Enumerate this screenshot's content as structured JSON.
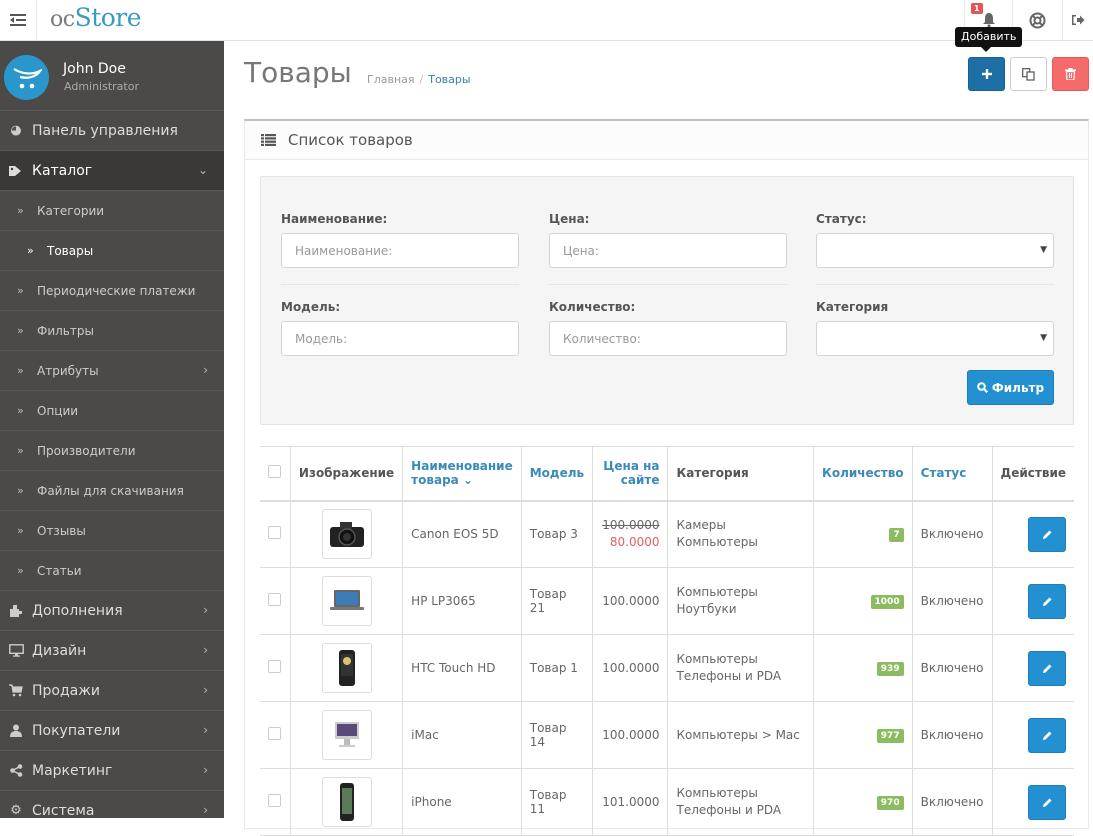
{
  "header": {
    "logo_prefix": "oc",
    "logo_brand": "Store",
    "notifications_count": "1",
    "tooltip": "Добавить"
  },
  "profile": {
    "name": "John Doe",
    "role": "Administrator"
  },
  "sidebar": {
    "items": [
      {
        "label": "Панель управления",
        "icon": "dashboard-icon"
      },
      {
        "label": "Каталог",
        "icon": "tags-icon",
        "expanded": true
      },
      {
        "label": "Дополнения",
        "icon": "puzzle-icon"
      },
      {
        "label": "Дизайн",
        "icon": "monitor-icon"
      },
      {
        "label": "Продажи",
        "icon": "cart-icon"
      },
      {
        "label": "Покупатели",
        "icon": "user-icon"
      },
      {
        "label": "Маркетинг",
        "icon": "share-icon"
      },
      {
        "label": "Система",
        "icon": "gear-icon"
      }
    ],
    "catalog_sub": [
      {
        "label": "Категории"
      },
      {
        "label": "Товары",
        "active": true
      },
      {
        "label": "Периодические платежи"
      },
      {
        "label": "Фильтры"
      },
      {
        "label": "Атрибуты",
        "has_children": true
      },
      {
        "label": "Опции"
      },
      {
        "label": "Производители"
      },
      {
        "label": "Файлы для скачивания"
      },
      {
        "label": "Отзывы"
      },
      {
        "label": "Статьи"
      }
    ]
  },
  "page": {
    "title": "Товары",
    "breadcrumb": [
      "Главная",
      "Товары"
    ],
    "panel_title": "Список товаров"
  },
  "filter": {
    "name_label": "Наименование:",
    "name_placeholder": "Наименование:",
    "price_label": "Цена:",
    "price_placeholder": "Цена:",
    "status_label": "Статус:",
    "status_value": "",
    "model_label": "Модель:",
    "model_placeholder": "Модель:",
    "quantity_label": "Количество:",
    "quantity_placeholder": "Количество:",
    "category_label": "Категория",
    "category_value": "",
    "button_label": "Фильтр"
  },
  "table": {
    "columns": {
      "image": "Изображение",
      "name": "Наименование товара",
      "model": "Модель",
      "price": "Цена на сайте",
      "category": "Категория",
      "quantity": "Количество",
      "status": "Статус",
      "action": "Действие"
    },
    "rows": [
      {
        "name": "Canon EOS 5D",
        "model": "Товар 3",
        "price": "100.0000",
        "special": "80.0000",
        "category": [
          "Камеры",
          "Компьютеры"
        ],
        "quantity": "7",
        "status": "Включено",
        "image": "camera"
      },
      {
        "name": "HP LP3065",
        "model": "Товар 21",
        "price": "100.0000",
        "special": "",
        "category": [
          "Компьютеры",
          "Ноутбуки"
        ],
        "quantity": "1000",
        "status": "Включено",
        "image": "laptop"
      },
      {
        "name": "HTC Touch HD",
        "model": "Товар 1",
        "price": "100.0000",
        "special": "",
        "category": [
          "Компьютеры",
          "Телефоны и PDA"
        ],
        "quantity": "939",
        "status": "Включено",
        "image": "phone"
      },
      {
        "name": "iMac",
        "model": "Товар 14",
        "price": "100.0000",
        "special": "",
        "category": [
          "Компьютеры  >  Mac"
        ],
        "quantity": "977",
        "status": "Включено",
        "image": "imac"
      },
      {
        "name": "iPhone",
        "model": "Товар 11",
        "price": "101.0000",
        "special": "",
        "category": [
          "Компьютеры",
          "Телефоны и PDA"
        ],
        "quantity": "970",
        "status": "Включено",
        "image": "iphone"
      }
    ]
  }
}
